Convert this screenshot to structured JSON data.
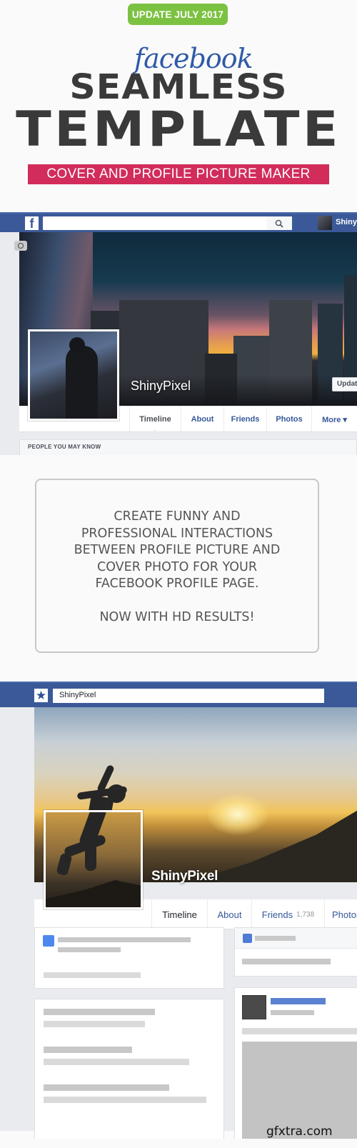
{
  "hero": {
    "badge": "UPDATE JULY 2017",
    "script_word": "facebook",
    "title_line1": "SEAMLESS",
    "title_line2": "TEMPLATE",
    "subtitle": "COVER AND PROFILE PICTURE MAKER",
    "colors": {
      "badge": "#7cc242",
      "subtitle_bg": "#d22c5b",
      "title": "#3a3a3a",
      "script": "#2f5aa8"
    }
  },
  "mockup1": {
    "logo": "f",
    "search_placeholder": "",
    "user_name_truncated": "ShinyP",
    "profile_name": "ShinyPixel",
    "update_button": "Update",
    "tabs": [
      {
        "label": "Timeline",
        "active": true
      },
      {
        "label": "About",
        "active": false
      },
      {
        "label": "Friends",
        "active": false
      },
      {
        "label": "Photos",
        "active": false
      },
      {
        "label": "More ▾",
        "active": false
      }
    ],
    "section_header": "PEOPLE YOU MAY KNOW",
    "brand_color": "#3b5998"
  },
  "info": {
    "text": "CREATE FUNNY AND\nPROFESSIONAL INTERACTIONS\nBETWEEN PROFILE PICTURE AND\nCOVER PHOTO FOR YOUR\nFACEBOOK PROFILE PAGE.\n\nNOW WITH HD RESULTS!"
  },
  "mockup2": {
    "search_value": "ShinyPixel",
    "profile_name": "ShinyPixel",
    "tabs": [
      {
        "label": "Timeline",
        "active": true
      },
      {
        "label": "About",
        "active": false
      },
      {
        "label": "Friends",
        "count": "1,738",
        "active": false
      },
      {
        "label": "Photos",
        "active": false
      }
    ]
  },
  "watermark": "gfxtra.com"
}
